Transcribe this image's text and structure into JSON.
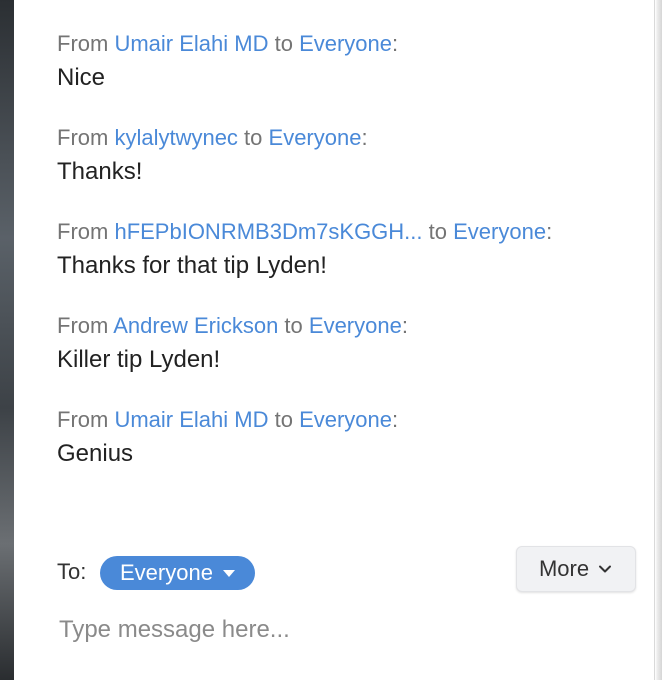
{
  "chat": {
    "from_word": "From ",
    "to_word": " to ",
    "colon": ":",
    "messages": [
      {
        "sender": "Umair Elahi MD",
        "recipient": "Everyone",
        "text": "Nice"
      },
      {
        "sender": "kylalytwynec",
        "recipient": "Everyone",
        "text": "Thanks!"
      },
      {
        "sender": "hFEPbIONRMB3Dm7sKGGH...",
        "recipient": "Everyone",
        "text": "Thanks for that tip Lyden!"
      },
      {
        "sender": "Andrew Erickson",
        "recipient": "Everyone",
        "text": "Killer tip Lyden!"
      },
      {
        "sender": "Umair Elahi MD",
        "recipient": "Everyone",
        "text": "Genius"
      }
    ]
  },
  "composer": {
    "to_label": "To:",
    "recipient": "Everyone",
    "more_label": "More",
    "placeholder": "Type message here...",
    "value": ""
  },
  "colors": {
    "accent": "#4a89d8",
    "muted_text": "#747474",
    "body_text": "#222222"
  },
  "icons": {
    "recipient_caret": "caret-down-icon",
    "more_chevron": "chevron-down-icon"
  }
}
